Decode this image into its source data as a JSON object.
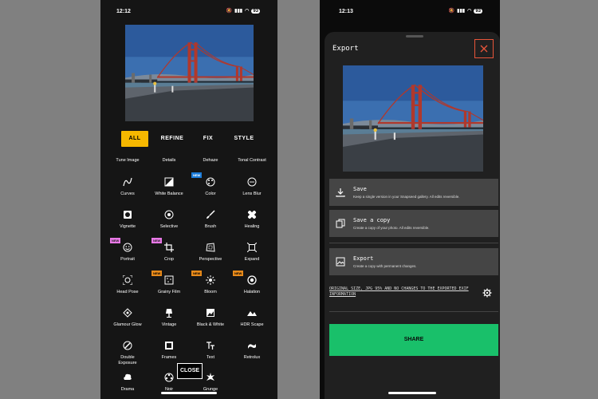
{
  "left_phone": {
    "status": {
      "time": "12:12",
      "battery": "93"
    },
    "tabs": [
      {
        "label": "ALL",
        "active": true
      },
      {
        "label": "REFINE",
        "active": false
      },
      {
        "label": "FIX",
        "active": false
      },
      {
        "label": "STYLE",
        "active": false
      }
    ],
    "tools": [
      {
        "label": "Tune Image"
      },
      {
        "label": "Details"
      },
      {
        "label": "Dehaze"
      },
      {
        "label": "Tonal Contrast"
      },
      {
        "label": "Curves",
        "icon": "curves-icon"
      },
      {
        "label": "White Balance",
        "icon": "white-balance-icon"
      },
      {
        "label": "Color",
        "icon": "palette-icon",
        "badge": "NEW"
      },
      {
        "label": "Lens Blur",
        "icon": "lens-blur-icon"
      },
      {
        "label": "Vignette",
        "icon": "vignette-icon"
      },
      {
        "label": "Selective",
        "icon": "selective-icon"
      },
      {
        "label": "Brush",
        "icon": "brush-icon"
      },
      {
        "label": "Healing",
        "icon": "healing-icon"
      },
      {
        "label": "Portrait",
        "icon": "portrait-icon",
        "badge": "NEW"
      },
      {
        "label": "Crop",
        "icon": "crop-icon",
        "badge": "NEW"
      },
      {
        "label": "Perspective",
        "icon": "perspective-icon"
      },
      {
        "label": "Expand",
        "icon": "expand-icon"
      },
      {
        "label": "Head Pose",
        "icon": "head-pose-icon"
      },
      {
        "label": "Grainy Film",
        "icon": "grainy-film-icon",
        "badge": "NEW"
      },
      {
        "label": "Bloom",
        "icon": "bloom-icon",
        "badge": "NEW"
      },
      {
        "label": "Halation",
        "icon": "halation-icon",
        "badge": "NEW"
      },
      {
        "label": "Glamour Glow",
        "icon": "glamour-glow-icon"
      },
      {
        "label": "Vintage",
        "icon": "vintage-icon"
      },
      {
        "label": "Black & White",
        "icon": "black-white-icon"
      },
      {
        "label": "HDR Scape",
        "icon": "hdr-scape-icon"
      },
      {
        "label": "Double Exposure",
        "icon": "double-exposure-icon"
      },
      {
        "label": "Frames",
        "icon": "frames-icon"
      },
      {
        "label": "Text",
        "icon": "text-icon"
      },
      {
        "label": "Retrolux",
        "icon": "retrolux-icon"
      },
      {
        "label": "Drama",
        "icon": "drama-icon"
      },
      {
        "label": "Noir",
        "icon": "noir-icon"
      },
      {
        "label": "Grunge",
        "icon": "grunge-icon"
      }
    ],
    "close_label": "CLOSE",
    "colors": {
      "accent": "#f6b800",
      "badge_blue": "#1a7bd9",
      "badge_pink": "#e878e6",
      "badge_orange": "#e88a1a"
    }
  },
  "right_phone": {
    "status": {
      "time": "12:13",
      "battery": "93"
    },
    "title": "Export",
    "options": [
      {
        "title": "Save",
        "description": "Keep a single version in your Snapseed gallery. All edits reversible.",
        "icon": "download-icon"
      },
      {
        "title": "Save a copy",
        "description": "Create a copy of your photo. All edits reversible.",
        "icon": "copy-icon"
      },
      {
        "title": "Export",
        "description": "Create a copy with permanent changes.",
        "icon": "image-icon"
      }
    ],
    "settings_text": "Original size, JPG 95% and no changes to the exported EXIF information",
    "share_label": "SHARE",
    "colors": {
      "share": "#19c06a",
      "close_border": "#e8553a"
    }
  }
}
